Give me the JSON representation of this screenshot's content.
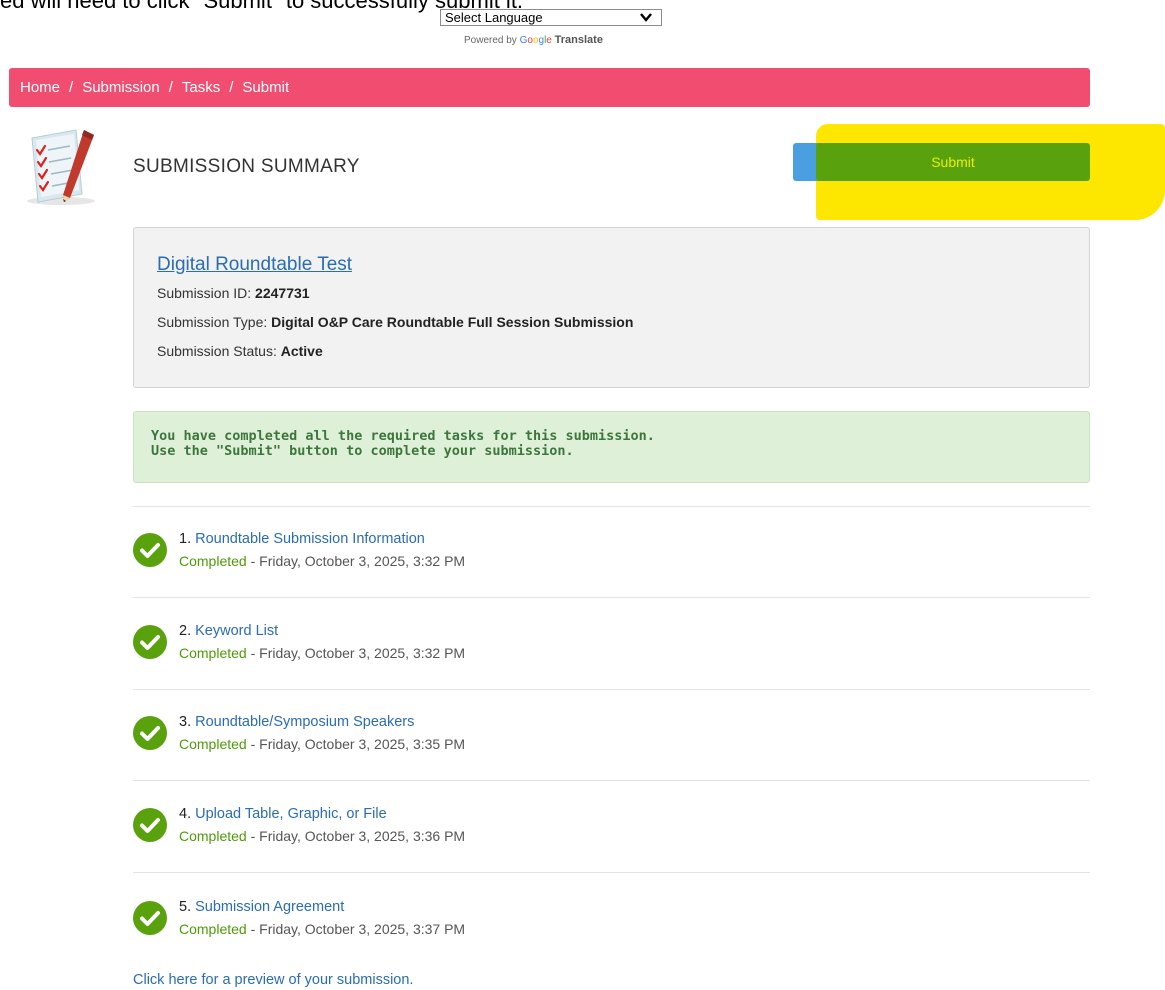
{
  "instruction_text": "ed will need to click \"Submit\" to successfully submit it.",
  "translate": {
    "select_label": "Select Language",
    "powered_by": "Powered by",
    "google": "Google",
    "translate_word": "Translate"
  },
  "breadcrumb": {
    "items": [
      "Home",
      "Submission",
      "Tasks",
      "Submit"
    ],
    "separator": "/"
  },
  "header": {
    "title": "SUBMISSION SUMMARY",
    "submit_label": "Submit"
  },
  "submission": {
    "title": "Digital Roundtable Test",
    "id_label": "Submission ID:",
    "id_value": "2247731",
    "type_label": "Submission Type:",
    "type_value": "Digital O&P Care Roundtable Full Session Submission",
    "status_label": "Submission Status:",
    "status_value": "Active"
  },
  "notice": {
    "line1": "You have completed all the required tasks for this submission.",
    "line2": "Use the \"Submit\" button to complete your submission."
  },
  "tasks": [
    {
      "num": "1.",
      "title": "Roundtable Submission Information",
      "status": "Completed",
      "timestamp": " - Friday, October 3, 2025, 3:32 PM"
    },
    {
      "num": "2.",
      "title": "Keyword List",
      "status": "Completed",
      "timestamp": " - Friday, October 3, 2025, 3:32 PM"
    },
    {
      "num": "3.",
      "title": "Roundtable/Symposium Speakers",
      "status": "Completed",
      "timestamp": " - Friday, October 3, 2025, 3:35 PM"
    },
    {
      "num": "4.",
      "title": "Upload Table, Graphic, or File",
      "status": "Completed",
      "timestamp": " - Friday, October 3, 2025, 3:36 PM"
    },
    {
      "num": "5.",
      "title": "Submission Agreement",
      "status": "Completed",
      "timestamp": " - Friday, October 3, 2025, 3:37 PM"
    }
  ],
  "preview_link": "Click here for a preview of your submission.",
  "colors": {
    "breadcrumb_bg": "#f04d71",
    "submit_green": "#5aa10e",
    "submit_text": "#e9ee00",
    "highlight": "#fde700",
    "link_blue": "#2a6cb5",
    "success_bg": "#dff0d8",
    "success_text": "#3c763d",
    "check_green": "#5aa10e"
  },
  "icons": {
    "header": "checklist-pencil-icon",
    "task": "check-circle-icon",
    "dropdown": "chevron-down-icon"
  }
}
